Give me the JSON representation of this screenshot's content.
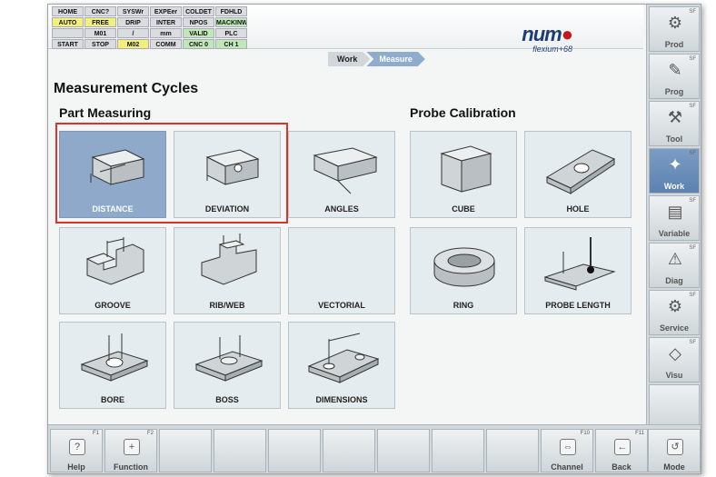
{
  "status_grid": [
    {
      "t": "HOME",
      "c": ""
    },
    {
      "t": "CNC?",
      "c": ""
    },
    {
      "t": "SYSWr",
      "c": ""
    },
    {
      "t": "EXPEer",
      "c": ""
    },
    {
      "t": "COLDET",
      "c": ""
    },
    {
      "t": "FDHLD",
      "c": ""
    },
    {
      "t": "AUTO",
      "c": "y"
    },
    {
      "t": "FREE",
      "c": "y"
    },
    {
      "t": "DRIP",
      "c": ""
    },
    {
      "t": "INTER",
      "c": ""
    },
    {
      "t": "NPOS",
      "c": ""
    },
    {
      "t": "MACKINW",
      "c": "g"
    },
    {
      "t": "",
      "c": ""
    },
    {
      "t": "M01",
      "c": ""
    },
    {
      "t": "/",
      "c": ""
    },
    {
      "t": "mm",
      "c": ""
    },
    {
      "t": "VALID",
      "c": "g"
    },
    {
      "t": "PLC",
      "c": ""
    },
    {
      "t": "START",
      "c": ""
    },
    {
      "t": "STOP",
      "c": ""
    },
    {
      "t": "M02",
      "c": "y"
    },
    {
      "t": "COMM",
      "c": ""
    },
    {
      "t": "CNC 0",
      "c": "g"
    },
    {
      "t": "CH 1",
      "c": "g"
    }
  ],
  "logo": {
    "brand": "num",
    "sub": "flexium+68"
  },
  "breadcrumb": [
    "Work",
    "Measure"
  ],
  "page_title": "Measurement Cycles",
  "sections": {
    "part": "Part Measuring",
    "probe": "Probe Calibration"
  },
  "tiles": {
    "distance": "DISTANCE",
    "deviation": "DEVIATION",
    "angles": "ANGLES",
    "groove": "GROOVE",
    "ribweb": "RIB/WEB",
    "vectorial": "VECTORIAL",
    "bore": "BORE",
    "boss": "BOSS",
    "dimensions": "DIMENSIONS",
    "cube": "CUBE",
    "hole": "HOLE",
    "ring": "RING",
    "probe_length": "PROBE LENGTH"
  },
  "side_menu": [
    {
      "label": "Prod",
      "icon": "gear-icon"
    },
    {
      "label": "Prog",
      "icon": "pencil-icon"
    },
    {
      "label": "Tool",
      "icon": "tool-icon"
    },
    {
      "label": "Work",
      "icon": "work-icon",
      "active": true
    },
    {
      "label": "Variable",
      "icon": "variable-icon"
    },
    {
      "label": "Diag",
      "icon": "diag-icon"
    },
    {
      "label": "Service",
      "icon": "service-icon"
    },
    {
      "label": "Visu",
      "icon": "visu-icon"
    }
  ],
  "function_keys": [
    {
      "fn": "F1",
      "label": "Help"
    },
    {
      "fn": "F2",
      "label": "Function"
    },
    {
      "fn": "F10",
      "label": "Channel"
    },
    {
      "fn": "F11",
      "label": "Back"
    },
    {
      "fn": "",
      "label": "Mode"
    }
  ],
  "colors": {
    "accent": "#8ea9c9",
    "highlight": "#d9342b",
    "brand_blue": "#1b3c78",
    "brand_red": "#c31a22"
  }
}
